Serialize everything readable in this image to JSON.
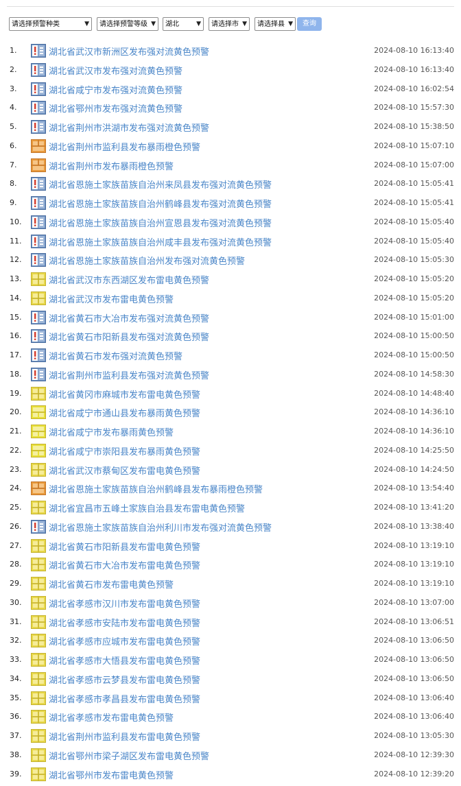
{
  "filters": {
    "type_label": "请选择预警种类",
    "level_label": "请选择预警等级",
    "province_label": "湖北",
    "city_label": "请选择市",
    "county_label": "请选择县",
    "query_label": "查询"
  },
  "colors": {
    "link": "#4a86c8",
    "query_button": "#8fb5ec",
    "icon_blue": "#3b78c4",
    "icon_yellow": "#e8d84a",
    "icon_orange": "#e89a3c"
  },
  "alerts": [
    {
      "n": "1.",
      "icon": "convection-blue",
      "title": "湖北省武汉市新洲区发布强对流黄色预警",
      "time": "2024-08-10 16:13:40"
    },
    {
      "n": "2.",
      "icon": "convection-blue",
      "title": "湖北省武汉市发布强对流黄色预警",
      "time": "2024-08-10 16:13:40"
    },
    {
      "n": "3.",
      "icon": "convection-blue",
      "title": "湖北省咸宁市发布强对流黄色预警",
      "time": "2024-08-10 16:02:54"
    },
    {
      "n": "4.",
      "icon": "convection-blue",
      "title": "湖北省鄂州市发布强对流黄色预警",
      "time": "2024-08-10 15:57:30"
    },
    {
      "n": "5.",
      "icon": "convection-blue",
      "title": "湖北省荆州市洪湖市发布强对流黄色预警",
      "time": "2024-08-10 15:38:50"
    },
    {
      "n": "6.",
      "icon": "rainstorm-orange",
      "title": "湖北省荆州市监利县发布暴雨橙色预警",
      "time": "2024-08-10 15:07:10"
    },
    {
      "n": "7.",
      "icon": "rainstorm-orange",
      "title": "湖北省荆州市发布暴雨橙色预警",
      "time": "2024-08-10 15:07:00"
    },
    {
      "n": "8.",
      "icon": "convection-blue",
      "title": "湖北省恩施土家族苗族自治州来凤县发布强对流黄色预警",
      "time": "2024-08-10 15:05:41"
    },
    {
      "n": "9.",
      "icon": "convection-blue",
      "title": "湖北省恩施土家族苗族自治州鹤峰县发布强对流黄色预警",
      "time": "2024-08-10 15:05:41"
    },
    {
      "n": "10.",
      "icon": "convection-blue",
      "title": "湖北省恩施土家族苗族自治州宣恩县发布强对流黄色预警",
      "time": "2024-08-10 15:05:40"
    },
    {
      "n": "11.",
      "icon": "convection-blue",
      "title": "湖北省恩施土家族苗族自治州咸丰县发布强对流黄色预警",
      "time": "2024-08-10 15:05:40"
    },
    {
      "n": "12.",
      "icon": "convection-blue",
      "title": "湖北省恩施土家族苗族自治州发布强对流黄色预警",
      "time": "2024-08-10 15:05:30"
    },
    {
      "n": "13.",
      "icon": "thunder-yellow",
      "title": "湖北省武汉市东西湖区发布雷电黄色预警",
      "time": "2024-08-10 15:05:20"
    },
    {
      "n": "14.",
      "icon": "thunder-yellow",
      "title": "湖北省武汉市发布雷电黄色预警",
      "time": "2024-08-10 15:05:20"
    },
    {
      "n": "15.",
      "icon": "convection-blue",
      "title": "湖北省黄石市大冶市发布强对流黄色预警",
      "time": "2024-08-10 15:01:00"
    },
    {
      "n": "16.",
      "icon": "convection-blue",
      "title": "湖北省黄石市阳新县发布强对流黄色预警",
      "time": "2024-08-10 15:00:50"
    },
    {
      "n": "17.",
      "icon": "convection-blue",
      "title": "湖北省黄石市发布强对流黄色预警",
      "time": "2024-08-10 15:00:50"
    },
    {
      "n": "18.",
      "icon": "convection-blue",
      "title": "湖北省荆州市监利县发布强对流黄色预警",
      "time": "2024-08-10 14:58:30"
    },
    {
      "n": "19.",
      "icon": "thunder-yellow",
      "title": "湖北省黄冈市麻城市发布雷电黄色预警",
      "time": "2024-08-10 14:48:40"
    },
    {
      "n": "20.",
      "icon": "rainstorm-yellow",
      "title": "湖北省咸宁市通山县发布暴雨黄色预警",
      "time": "2024-08-10 14:36:10"
    },
    {
      "n": "21.",
      "icon": "rainstorm-yellow",
      "title": "湖北省咸宁市发布暴雨黄色预警",
      "time": "2024-08-10 14:36:10"
    },
    {
      "n": "22.",
      "icon": "rainstorm-yellow",
      "title": "湖北省咸宁市崇阳县发布暴雨黄色预警",
      "time": "2024-08-10 14:25:50"
    },
    {
      "n": "23.",
      "icon": "thunder-yellow",
      "title": "湖北省武汉市蔡甸区发布雷电黄色预警",
      "time": "2024-08-10 14:24:50"
    },
    {
      "n": "24.",
      "icon": "rainstorm-orange",
      "title": "湖北省恩施土家族苗族自治州鹤峰县发布暴雨橙色预警",
      "time": "2024-08-10 13:54:40"
    },
    {
      "n": "25.",
      "icon": "thunder-yellow",
      "title": "湖北省宜昌市五峰土家族自治县发布雷电黄色预警",
      "time": "2024-08-10 13:41:20"
    },
    {
      "n": "26.",
      "icon": "convection-blue",
      "title": "湖北省恩施土家族苗族自治州利川市发布强对流黄色预警",
      "time": "2024-08-10 13:38:40"
    },
    {
      "n": "27.",
      "icon": "thunder-yellow",
      "title": "湖北省黄石市阳新县发布雷电黄色预警",
      "time": "2024-08-10 13:19:10"
    },
    {
      "n": "28.",
      "icon": "thunder-yellow",
      "title": "湖北省黄石市大冶市发布雷电黄色预警",
      "time": "2024-08-10 13:19:10"
    },
    {
      "n": "29.",
      "icon": "thunder-yellow",
      "title": "湖北省黄石市发布雷电黄色预警",
      "time": "2024-08-10 13:19:10"
    },
    {
      "n": "30.",
      "icon": "thunder-yellow",
      "title": "湖北省孝感市汉川市发布雷电黄色预警",
      "time": "2024-08-10 13:07:00"
    },
    {
      "n": "31.",
      "icon": "thunder-yellow",
      "title": "湖北省孝感市安陆市发布雷电黄色预警",
      "time": "2024-08-10 13:06:51"
    },
    {
      "n": "32.",
      "icon": "thunder-yellow",
      "title": "湖北省孝感市应城市发布雷电黄色预警",
      "time": "2024-08-10 13:06:50"
    },
    {
      "n": "33.",
      "icon": "thunder-yellow",
      "title": "湖北省孝感市大悟县发布雷电黄色预警",
      "time": "2024-08-10 13:06:50"
    },
    {
      "n": "34.",
      "icon": "thunder-yellow",
      "title": "湖北省孝感市云梦县发布雷电黄色预警",
      "time": "2024-08-10 13:06:50"
    },
    {
      "n": "35.",
      "icon": "thunder-yellow",
      "title": "湖北省孝感市孝昌县发布雷电黄色预警",
      "time": "2024-08-10 13:06:40"
    },
    {
      "n": "36.",
      "icon": "thunder-yellow",
      "title": "湖北省孝感市发布雷电黄色预警",
      "time": "2024-08-10 13:06:40"
    },
    {
      "n": "37.",
      "icon": "thunder-yellow",
      "title": "湖北省荆州市监利县发布雷电黄色预警",
      "time": "2024-08-10 13:05:30"
    },
    {
      "n": "38.",
      "icon": "thunder-yellow",
      "title": "湖北省鄂州市梁子湖区发布雷电黄色预警",
      "time": "2024-08-10 12:39:30"
    },
    {
      "n": "39.",
      "icon": "thunder-yellow",
      "title": "湖北省鄂州市发布雷电黄色预警",
      "time": "2024-08-10 12:39:20"
    }
  ]
}
